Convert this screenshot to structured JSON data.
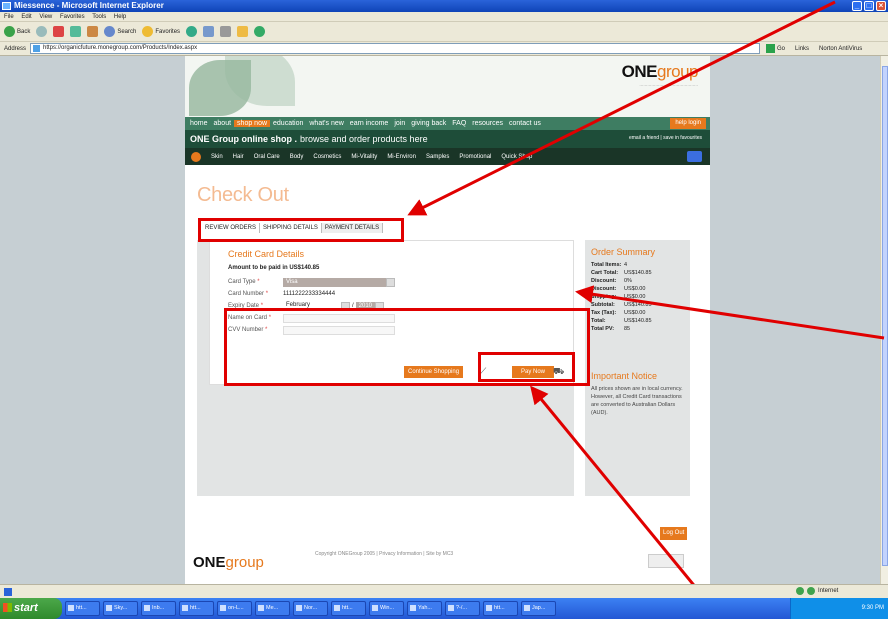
{
  "window": {
    "title": "Miessence - Microsoft Internet Explorer",
    "menu": [
      "File",
      "Edit",
      "View",
      "Favorites",
      "Tools",
      "Help"
    ],
    "toolbar": {
      "back": "Back",
      "search": "Search",
      "favorites": "Favorites"
    },
    "address_label": "Address",
    "url": "https://organicfuture.monegroup.com/Products/Index.aspx",
    "go_label": "Go",
    "links_label": "Links",
    "norton_label": "Norton AntiVirus"
  },
  "site": {
    "logo": {
      "part1": "ONE",
      "part2": "group"
    },
    "main_nav": [
      "home",
      "about",
      "shop now",
      "education",
      "what's new",
      "earn income",
      "join",
      "giving back",
      "FAQ",
      "resources",
      "contact us"
    ],
    "active_nav": "shop now",
    "help_login": "help login",
    "shop_title": "ONE Group online shop .",
    "shop_subtitle": "browse and order products here",
    "shop_tools": "email a friend  |  save in favourites",
    "categories": [
      "Skin",
      "Hair",
      "Oral Care",
      "Body",
      "Cosmetics",
      "Mi-Vitality",
      "Mi-Environ",
      "Samples",
      "Promotional",
      "Quick Shop"
    ]
  },
  "checkout": {
    "page_title": "Check Out",
    "steps": [
      "REVIEW ORDERS",
      "SHIPPING DETAILS",
      "PAYMENT DETAILS"
    ],
    "cc_title": "Credit Card Details",
    "amount": "Amount to be paid in US$140.85",
    "fields": {
      "card_type_label": "Card Type",
      "card_type_value": "Visa",
      "card_number_label": "Card Number",
      "card_number_value": "1111222233334444",
      "expiry_label": "Expiry Date",
      "expiry_month": "February",
      "expiry_sep": "/",
      "expiry_year": "2010",
      "name_label": "Name on Card",
      "name_value": "",
      "cvv_label": "CVV Number",
      "cvv_value": ""
    },
    "continue_label": "Continue Shopping",
    "paynow_label": "Pay Now",
    "logout_label": "Log Out"
  },
  "summary": {
    "title": "Order Summary",
    "rows": [
      {
        "k": "Total Items:",
        "v": "4"
      },
      {
        "k": "Cart Total:",
        "v": "US$140.85"
      },
      {
        "k": "Discount:",
        "v": "0%"
      },
      {
        "k": "Discount:",
        "v": "US$0.00"
      },
      {
        "k": "Shipping:",
        "v": "US$0.00"
      },
      {
        "k": "Subtotal:",
        "v": "US$140.85"
      },
      {
        "k": "Tax (Tax):",
        "v": "US$0.00"
      },
      {
        "k": "Total:",
        "v": "US$140.85"
      },
      {
        "k": "Total PV:",
        "v": "85"
      }
    ],
    "notice_title": "Important Notice",
    "notice_body": "All prices shown are in local currency. However, all Credit Card transactions are converted to Australian Dollars (AUD)."
  },
  "footer": {
    "links": "Copyright ONEGroup 2005  |  Privacy Information  |  Site by MC3"
  },
  "status": {
    "zone": "Internet"
  },
  "taskbar": {
    "start": "start",
    "tasks": [
      "htt...",
      "Sky...",
      "Inb...",
      "htt...",
      "on-L...",
      "Me...",
      "Nor...",
      "htt...",
      "Win...",
      "Yah...",
      "?-/...",
      "htt...",
      "Jap..."
    ],
    "clock": "9:30 PM"
  },
  "colors": {
    "accent": "#e6791d",
    "nav_green": "#3e7d62",
    "annotation": "#e00000"
  }
}
